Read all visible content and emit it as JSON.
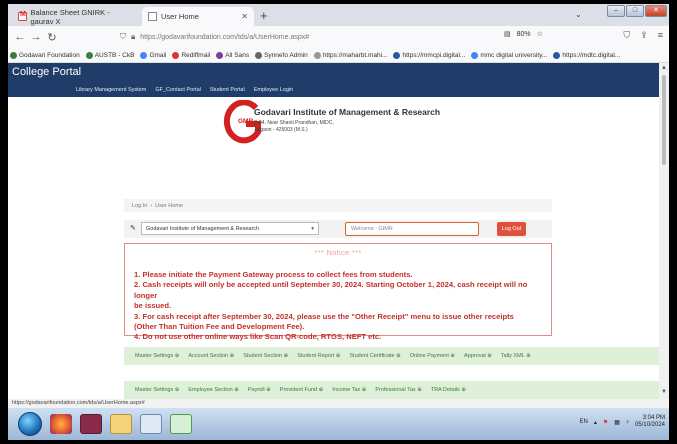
{
  "browser": {
    "tabs": [
      {
        "label": "Balance Sheet GNIRK - gaurav X",
        "icon": "gmail-icon"
      },
      {
        "label": "User Home",
        "icon": "page-icon"
      }
    ],
    "new_tab": "+",
    "url": "https://godavarifoundation.com/tds/a/UserHome.aspx#",
    "zoom": "80%",
    "bookmarks": [
      "Godavari Foundation",
      "AUSTB - CkB",
      "Gmail",
      "Rediffmail",
      "All Sans",
      "Synnefo Admin",
      "https://maharbt.mahi...",
      "https://mmcpi.digital...",
      "mmc digital university...",
      "https://mdtc.digital..."
    ],
    "status_url": "https://godavarifoundation.com/tds/a/UserHome.aspx#"
  },
  "portal": {
    "title": "College Portal",
    "menu": [
      "Library Management System",
      "GF_Contact Portal",
      "Student Portal",
      "Employee Login"
    ]
  },
  "institute": {
    "name": "Godavari Institute of Management & Research",
    "address1": "P-84, Near Shanti Prandhan, MIDC,",
    "address2": "Jalgaon - 425003 (M.S.)",
    "logo_text": "GMR"
  },
  "breadcrumb": [
    "Log In",
    "User Home"
  ],
  "selector": {
    "institute": "Godavari Institute of Management & Research",
    "welcome": "Welcome : GIMR",
    "logout": "Log Out"
  },
  "notice": {
    "title": "*** Notice ***",
    "lines": [
      "1. Please initiate the Payment Gateway process to collect fees from students.",
      "2. Cash receipts will only be accepted until September 30, 2024. Starting October 1, 2024, cash receipt will no longer",
      "be issued.",
      "3. For cash receipt after September 30, 2024, please use the \"Other Receipt\" menu to issue other receipts",
      "(Other Than Tuition Fee and Development Fee).",
      "4. Do not use other online ways like Scan QR-code, RTGS, NEFT etc."
    ]
  },
  "modules_row1": [
    "Master Settings",
    "Account Section",
    "Student Section",
    "Student Report",
    "Student Certificate",
    "Online Payment",
    "Approval",
    "Tally XML"
  ],
  "modules_row2": [
    "Master Settings",
    "Employee Section",
    "Payroll",
    "Provident Fund",
    "Income Tax",
    "Professional Tax",
    "TRA Details"
  ],
  "taskbar": {
    "clock_time": "3:04 PM",
    "clock_date": "05/10/2024",
    "lang": "EN"
  },
  "colors": {
    "portal_header": "#1f3d68",
    "notice_text": "#c4302b",
    "module_bg": "#dff0d8",
    "logout_bg": "#e0503b"
  }
}
